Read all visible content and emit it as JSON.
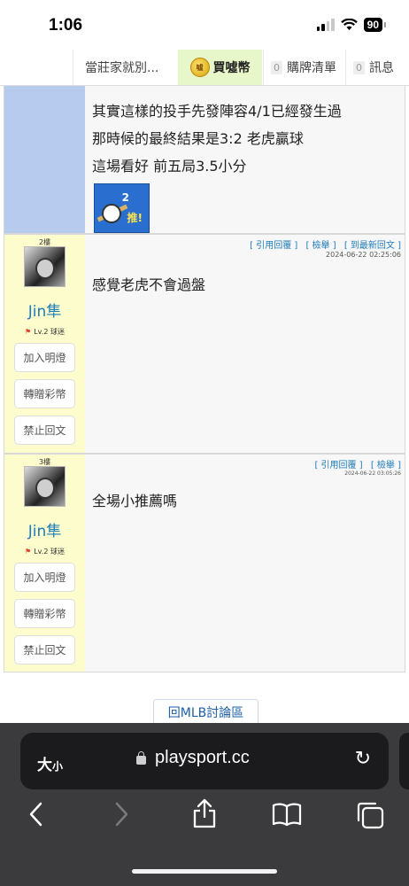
{
  "status": {
    "time": "1:06",
    "battery": "90"
  },
  "nav": {
    "home": "當莊家就別...",
    "buy_coin": "買噓幣",
    "coin_badge": "噓",
    "cart_count": "0",
    "cart": "購牌清單",
    "msg_count": "0",
    "msg": "訊息"
  },
  "posts": [
    {
      "lines": [
        "其實這樣的投手先發陣容4/1已經發生過",
        "那時候的最終結果是3:2 老虎贏球",
        "這場看好 前五局3.5小分"
      ],
      "sticker": {
        "num": "2",
        "text": "推!"
      }
    },
    {
      "floor": "2樓",
      "user": "Jin隼",
      "level": "Lv.2 球迷",
      "buttons": [
        "加入明燈",
        "轉贈彩幣",
        "禁止回文"
      ],
      "links": [
        "[ 引用回覆 ]",
        "[ 檢舉 ]",
        "[ 到最新回文 ]"
      ],
      "date": "2024-06-22 02:25:06",
      "text": "感覺老虎不會過盤"
    },
    {
      "floor": "3樓",
      "user": "Jin隼",
      "level": "Lv.2 球迷",
      "buttons": [
        "加入明燈",
        "轉贈彩幣",
        "禁止回文"
      ],
      "links": [
        "[ 引用回覆 ]",
        "[ 檢舉 ]"
      ],
      "date": "2024-06-22 03:05:26",
      "text": "全場小推薦嗎"
    }
  ],
  "back_button": "回MLB討論區",
  "browser": {
    "text_size": "大",
    "text_size_small": "小",
    "url": "playsport.cc"
  },
  "colors": {
    "link": "#1d7cb8",
    "user_sidebar": "#fcfccd",
    "op_sidebar": "#b7cbef",
    "buy_tab": "#e8f7c9"
  }
}
